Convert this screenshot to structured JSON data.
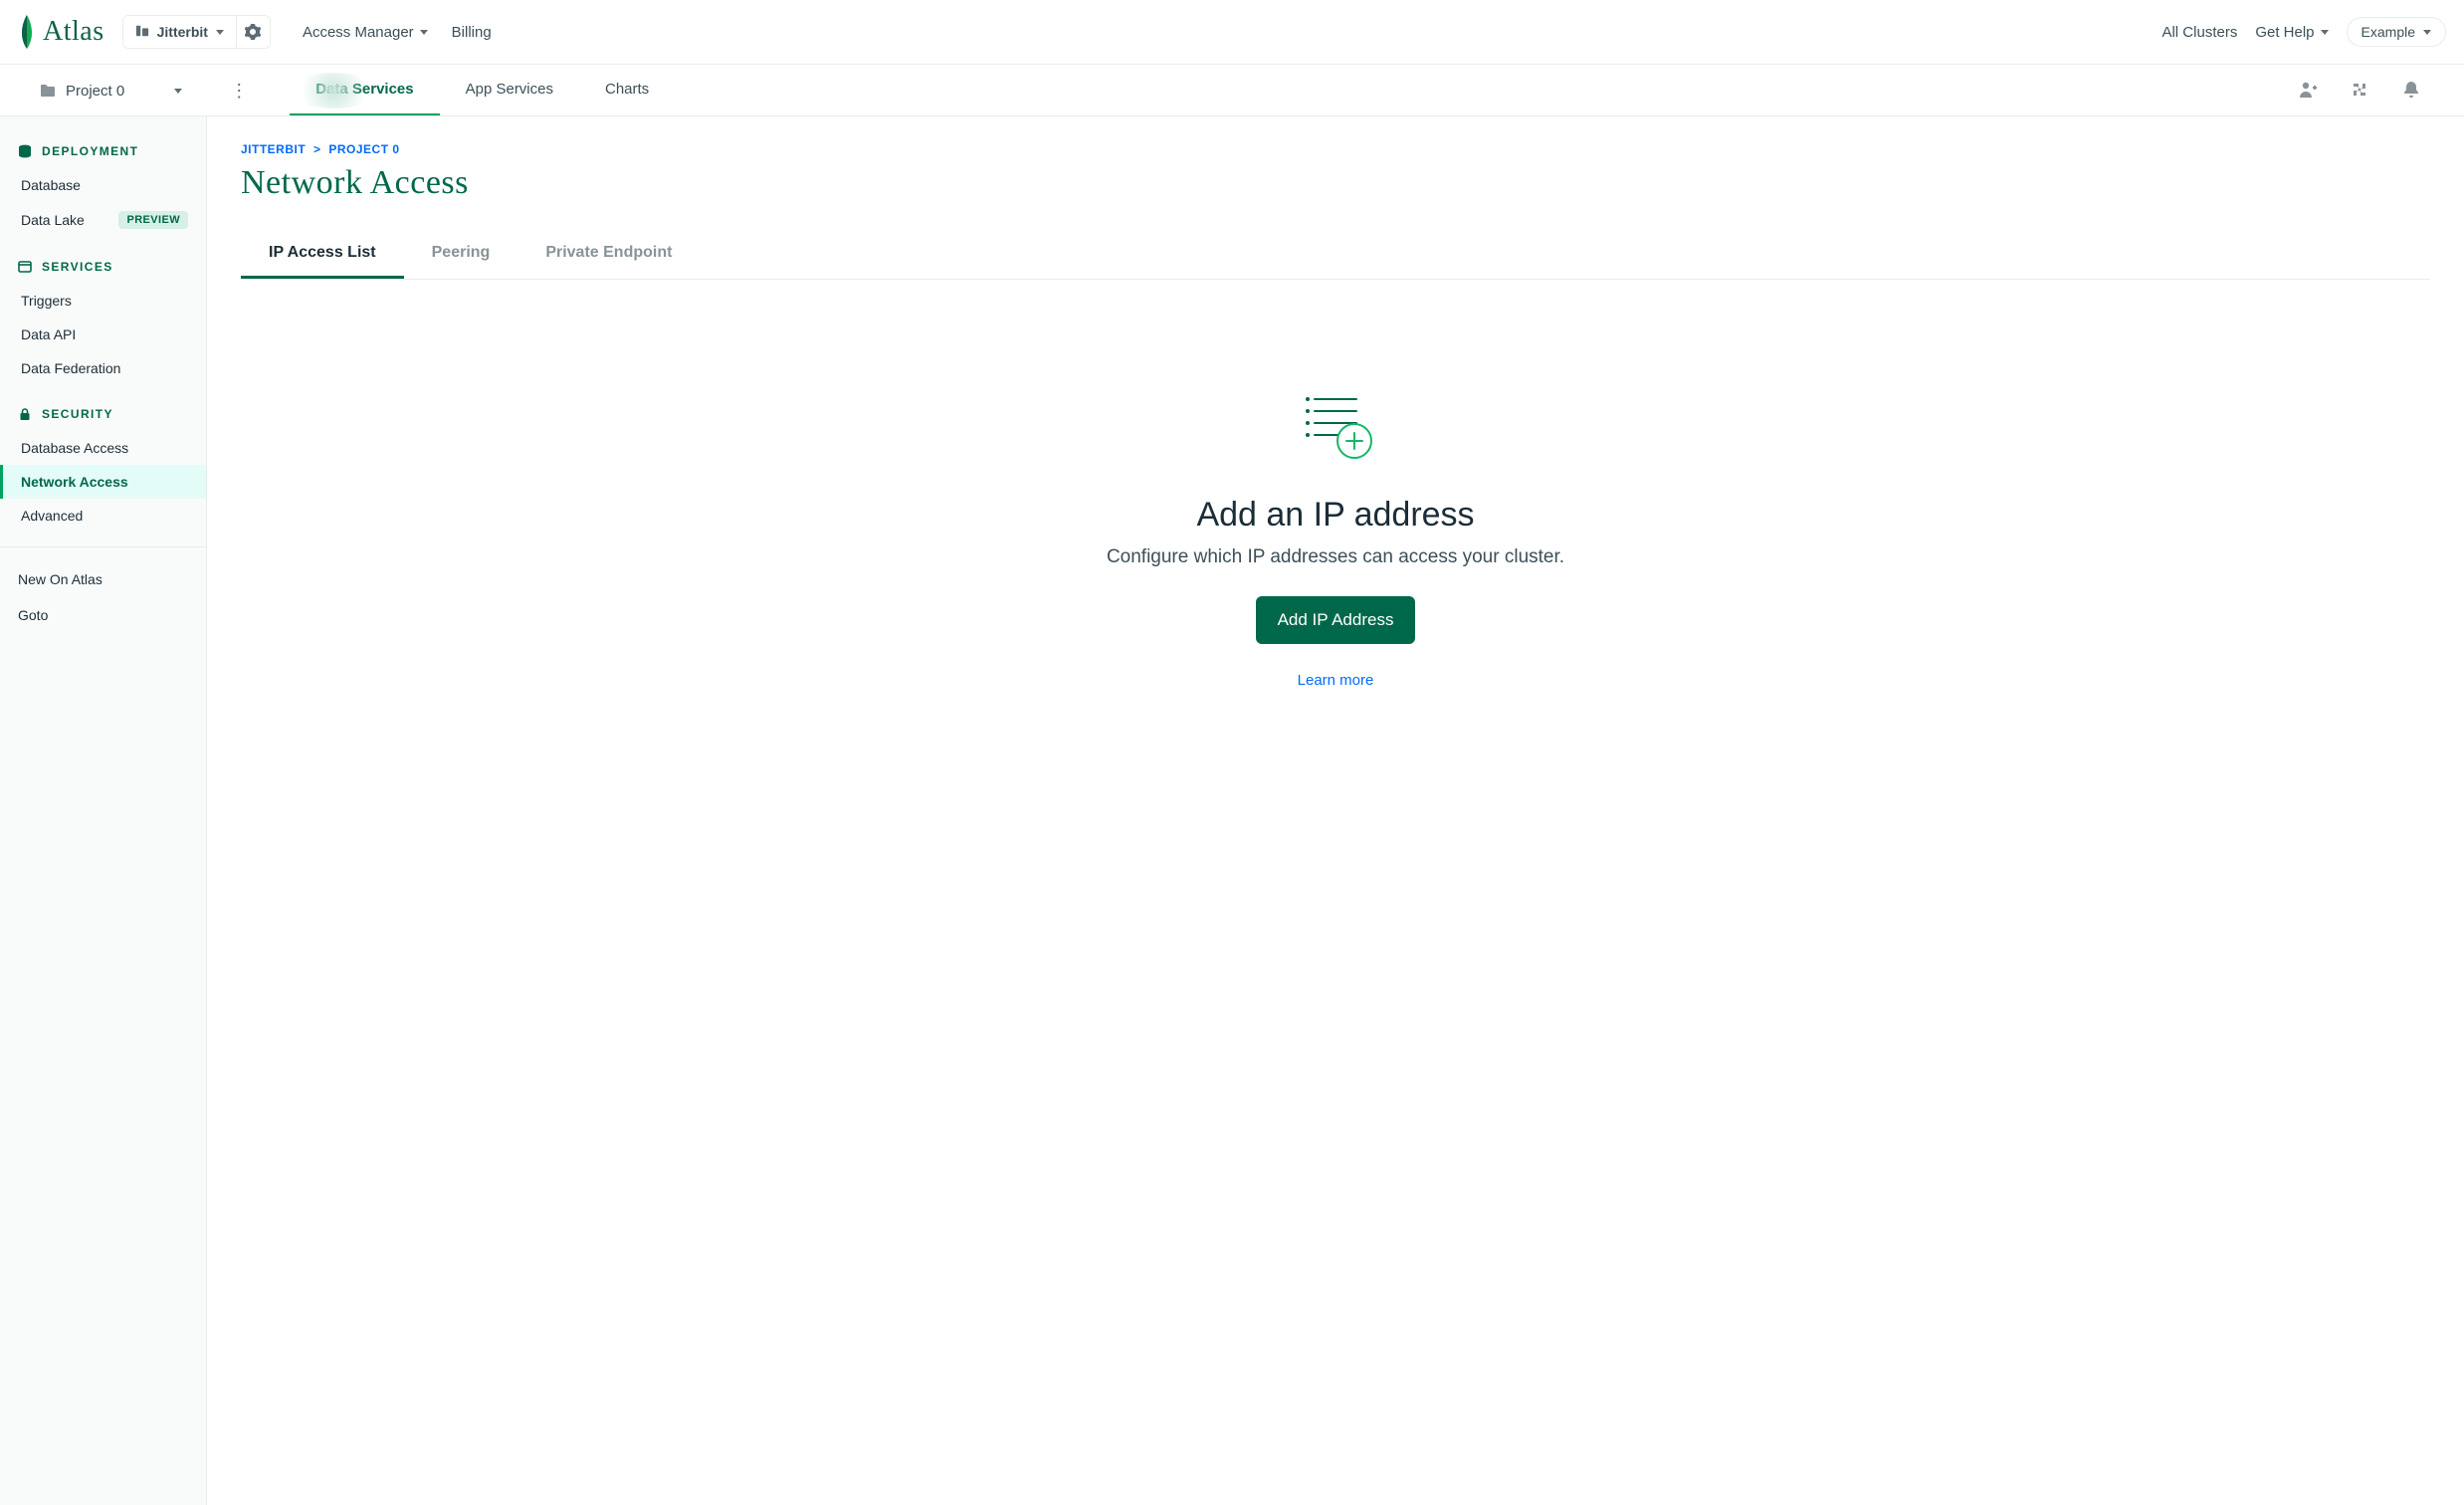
{
  "brand": "Atlas",
  "topbar": {
    "org_name": "Jitterbit",
    "access_manager": "Access Manager",
    "billing": "Billing",
    "all_clusters": "All Clusters",
    "get_help": "Get Help",
    "account": "Example"
  },
  "subbar": {
    "project_name": "Project 0",
    "tabs": [
      {
        "label": "Data Services",
        "active": true
      },
      {
        "label": "App Services",
        "active": false
      },
      {
        "label": "Charts",
        "active": false
      }
    ]
  },
  "sidebar": {
    "sections": [
      {
        "title": "DEPLOYMENT",
        "icon": "database",
        "items": [
          {
            "label": "Database"
          },
          {
            "label": "Data Lake",
            "badge": "PREVIEW"
          }
        ]
      },
      {
        "title": "SERVICES",
        "icon": "window",
        "items": [
          {
            "label": "Triggers"
          },
          {
            "label": "Data API"
          },
          {
            "label": "Data Federation"
          }
        ]
      },
      {
        "title": "SECURITY",
        "icon": "lock",
        "items": [
          {
            "label": "Database Access"
          },
          {
            "label": "Network Access",
            "active": true
          },
          {
            "label": "Advanced"
          }
        ]
      }
    ],
    "extras": [
      {
        "label": "New On Atlas"
      },
      {
        "label": "Goto"
      }
    ]
  },
  "breadcrumb": {
    "org": "JITTERBIT",
    "project": "PROJECT 0"
  },
  "page_title": "Network Access",
  "tabs": [
    {
      "label": "IP Access List",
      "active": true
    },
    {
      "label": "Peering",
      "active": false
    },
    {
      "label": "Private Endpoint",
      "active": false
    }
  ],
  "empty_state": {
    "title": "Add an IP address",
    "subtitle": "Configure which IP addresses can access your cluster.",
    "button": "Add IP Address",
    "learn_more": "Learn more"
  }
}
